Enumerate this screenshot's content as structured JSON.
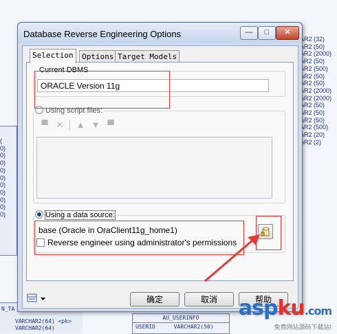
{
  "background": {
    "right_types": [
      "AR2 (32)",
      "AR2 (50)",
      "AR2 (2000)",
      "AR2 (50)",
      "",
      "",
      "",
      "",
      "",
      "",
      "",
      "AR2 (500)",
      "AR2 (50)",
      "AR2 (50)",
      "",
      "",
      "",
      "",
      "",
      "",
      "",
      "",
      "AR2 (2000)",
      "AR2 (2000)",
      "AR2 (50)",
      "AR2 (50)",
      "AR2 (50)",
      "AR2 (500)",
      "AR2 (20)",
      "AR2 (2)"
    ],
    "left_fragments": [
      "(",
      "0)",
      "0)",
      "0)",
      "",
      "",
      "0)",
      "0)",
      "0)",
      "0)",
      "0)",
      "0)",
      "0)"
    ],
    "bottom_left_rows": [
      "N_TA",
      "VARCHAR2(64)  <pk>",
      "VARCHAR2(64)"
    ],
    "table": {
      "name": "AU_USERINFO",
      "row_col": "USERID",
      "row_type": "VARCHAR2(50)"
    }
  },
  "dialog": {
    "title": "Database Reverse Engineering Options",
    "caption_buttons": [
      "—",
      "□",
      "✕"
    ],
    "tabs": [
      {
        "label": "Selection",
        "active": true
      },
      {
        "label": "Options",
        "active": false
      },
      {
        "label": "Target Models",
        "active": false
      }
    ],
    "current_dbms": {
      "legend": "Current DBMS",
      "value": "ORACLE Version 11g"
    },
    "script_files": {
      "label": "Using script files:",
      "selected": false
    },
    "data_source": {
      "label": "Using a data source:",
      "selected": true,
      "value": "base (Oracle in OraClient11g_home1)"
    },
    "admin_checkbox": {
      "label": "Reverse engineer using administrator's permissions",
      "checked": false
    },
    "buttons": {
      "ok": "确定",
      "cancel": "取消",
      "help": "帮助"
    }
  },
  "watermark": {
    "asp": "asp",
    "ku": "ku",
    "com": ".com",
    "sub": "免费网站源码下载站!"
  },
  "colors": {
    "accent_red": "#e33a3a",
    "wm_blue": "#2a6fc9",
    "wm_red": "#e3312d"
  }
}
